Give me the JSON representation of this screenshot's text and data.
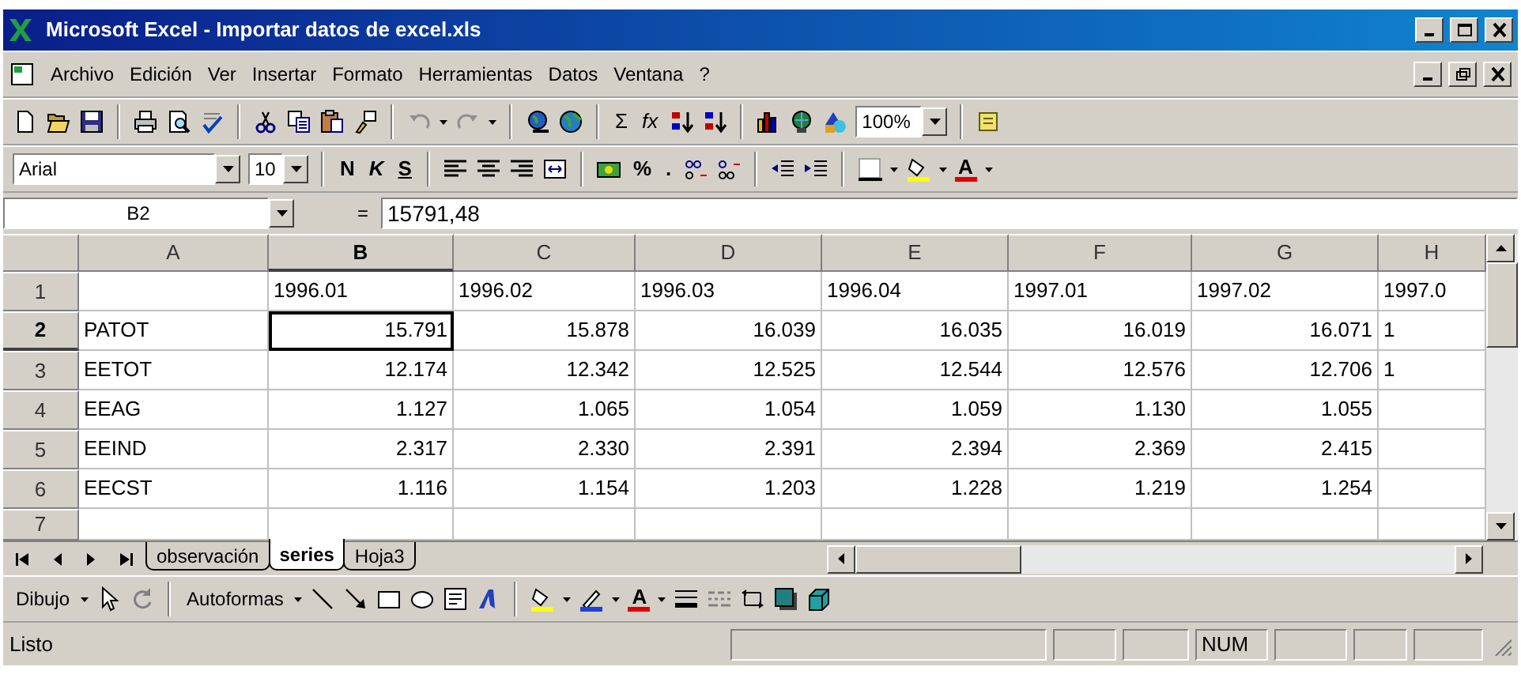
{
  "window": {
    "title": "Microsoft Excel - Importar datos de excel.xls"
  },
  "menu": [
    "Archivo",
    "Edición",
    "Ver",
    "Insertar",
    "Formato",
    "Herramientas",
    "Datos",
    "Ventana",
    "?"
  ],
  "standard_toolbar": {
    "sum": "Σ",
    "function": "fx",
    "zoom": "100%"
  },
  "formatting_toolbar": {
    "font": "Arial",
    "size": "10",
    "bold": "N",
    "italic": "K",
    "underline": "S",
    "percent": "%",
    "thousands": ".",
    "font_color": "A"
  },
  "formula_bar": {
    "name_box": "B2",
    "equals": "=",
    "value": "15791,48"
  },
  "sheet": {
    "columns": [
      {
        "label": "A",
        "selected": false
      },
      {
        "label": "B",
        "selected": true
      },
      {
        "label": "C",
        "selected": false
      },
      {
        "label": "D",
        "selected": false
      },
      {
        "label": "E",
        "selected": false
      },
      {
        "label": "F",
        "selected": false
      },
      {
        "label": "G",
        "selected": false
      },
      {
        "label": "H",
        "selected": false
      }
    ],
    "rows": [
      {
        "number": "1",
        "selected": false,
        "cells": [
          null,
          "1996.01",
          "1996.02",
          "1996.03",
          "1996.04",
          "1997.01",
          "1997.02",
          "1997.0"
        ]
      },
      {
        "number": "2",
        "selected": true,
        "cells": [
          "PATOT",
          "15.791",
          "15.878",
          "16.039",
          "16.035",
          "16.019",
          "16.071",
          "1"
        ]
      },
      {
        "number": "3",
        "selected": false,
        "cells": [
          "EETOT",
          "12.174",
          "12.342",
          "12.525",
          "12.544",
          "12.576",
          "12.706",
          "1"
        ]
      },
      {
        "number": "4",
        "selected": false,
        "cells": [
          "EEAG",
          "1.127",
          "1.065",
          "1.054",
          "1.059",
          "1.130",
          "1.055",
          null
        ]
      },
      {
        "number": "5",
        "selected": false,
        "cells": [
          "EEIND",
          "2.317",
          "2.330",
          "2.391",
          "2.394",
          "2.369",
          "2.415",
          null
        ]
      },
      {
        "number": "6",
        "selected": false,
        "cells": [
          "EECST",
          "1.116",
          "1.154",
          "1.203",
          "1.228",
          "1.219",
          "1.254",
          null
        ]
      },
      {
        "number": "7",
        "selected": false
      }
    ]
  },
  "sheet_tabs": [
    {
      "label": "observación",
      "selected": false
    },
    {
      "label": "series",
      "selected": true
    },
    {
      "label": "Hoja3",
      "selected": false
    }
  ],
  "drawing_toolbar": {
    "draw": "Dibujo",
    "autoshapes": "Autoformas",
    "font_color": "A"
  },
  "status_bar": {
    "text": "Listo",
    "indicator": "NUM"
  }
}
